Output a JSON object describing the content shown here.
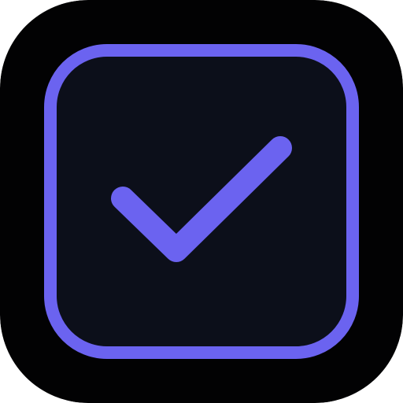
{
  "icon": {
    "name": "checkbox-checked-app-icon",
    "glyph": "check-icon",
    "colors": {
      "background": "#020203",
      "tile": "#0c0f1a",
      "accent": "#6b63f0"
    }
  }
}
